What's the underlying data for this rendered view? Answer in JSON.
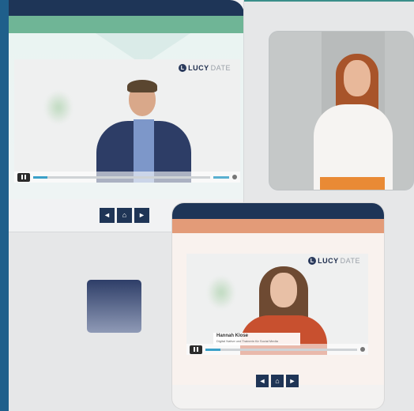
{
  "top_video": {
    "logo_letter": "L",
    "logo_prefix": "LUCY",
    "logo_suffix": "DATE",
    "time": "00:01"
  },
  "bottom_video": {
    "logo_letter": "L",
    "logo_prefix": "LUCY",
    "logo_suffix": "DATE",
    "speaker_name": "Hannah Klose",
    "speaker_role": "Digital Native und Trainerin für Social Media"
  },
  "nav_top": {
    "prev_icon": "◄",
    "home_icon": "⌂",
    "next_icon": "►"
  },
  "nav_bottom": {
    "prev_icon": "◄",
    "home_icon": "⌂",
    "next_icon": "►"
  },
  "colors": {
    "navy": "#1e3557",
    "green": "#6fb596",
    "orange": "#e39b78",
    "left_strip": "#1f5f8b"
  }
}
